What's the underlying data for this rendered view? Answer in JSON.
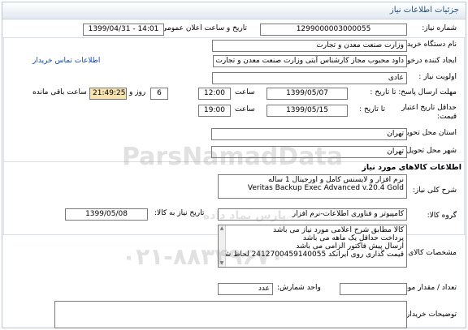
{
  "header": {
    "title": "جزئیات اطلاعات نیاز"
  },
  "need_number": {
    "label": "شماره نیاز:",
    "value": "1299000003000055"
  },
  "announce": {
    "label": "تاریخ و ساعت اعلان عمومی:",
    "value": "1399/04/31 - 14:01"
  },
  "buyer_org": {
    "label": "نام دستگاه خریدار:",
    "value": "وزارت صنعت معدن و تجارت"
  },
  "creator": {
    "label": "ایجاد کننده درخواست:",
    "value": "داود محبوب مجاز کارشناس آیتی وزارت صنعت معدن و تجارت",
    "contact_link": "اطلاعات تماس خریدار"
  },
  "priority": {
    "label": "اولویت نیاز :",
    "value": "عادی"
  },
  "reply_deadline": {
    "label": "مهلت ارسال پاسخ: تا تاریخ :",
    "date": "1399/05/07",
    "time_label": "ساعت",
    "time": "12:00",
    "days": "6",
    "days_label": "روز و",
    "remaining": "21:49:25",
    "remaining_label": "ساعت باقی مانده"
  },
  "price_validity": {
    "label_line1": "حداقل تاریخ اعتبار",
    "label_line2": "قیمت:",
    "to_date_label": "تا تاریخ :",
    "date": "1399/05/15",
    "time_label": "ساعت",
    "time": "19:00"
  },
  "delivery_province": {
    "label": "استان محل تحویل:",
    "value": "تهران"
  },
  "delivery_city": {
    "label": "شهر محل تحویل:",
    "value": "تهران"
  },
  "goods_section": {
    "title": "اطلاعات کالاهای مورد نیاز"
  },
  "general_desc": {
    "label": "شرح کلی نیاز:",
    "line1": "نرم افزار و لایسنس کامل و اورجینال 1 ساله",
    "line2": "Veritas Backup Exec Advanced v.20.4  Gold"
  },
  "goods_group": {
    "label": "گروه کالا:",
    "value": "کامپیوتر و فناوری اطلاعات-نرم افزار",
    "need_date_label": "تاریخ نیاز به کالا:",
    "need_date": "1399/05/08"
  },
  "specs": {
    "label": "مشخصات کالای مورد نیاز:",
    "lines": [
      "کالا مطابق شرح اعلامی مورد نیاز می باشد",
      "پرداخت حداقل یک ماهه می باشد",
      "ارسال پیش فاکتور الزامی می باشد",
      "قیمت گذاری روی ایرانکد 2412700459140055 لحاظ شود"
    ]
  },
  "quantity": {
    "label": "تعداد / مقدار مورد نیاز:",
    "unit_label": "واحد شمارش:",
    "unit": "عدد",
    "value": ""
  },
  "buyer_notes": {
    "label": "توضیحات خریدار:",
    "value": ""
  },
  "watermark": {
    "brand": "ParsNamadData",
    "phone": "۰۲۱-۸۸۳۴۹۶۷۰",
    "sub": "پارس نماد داده"
  }
}
